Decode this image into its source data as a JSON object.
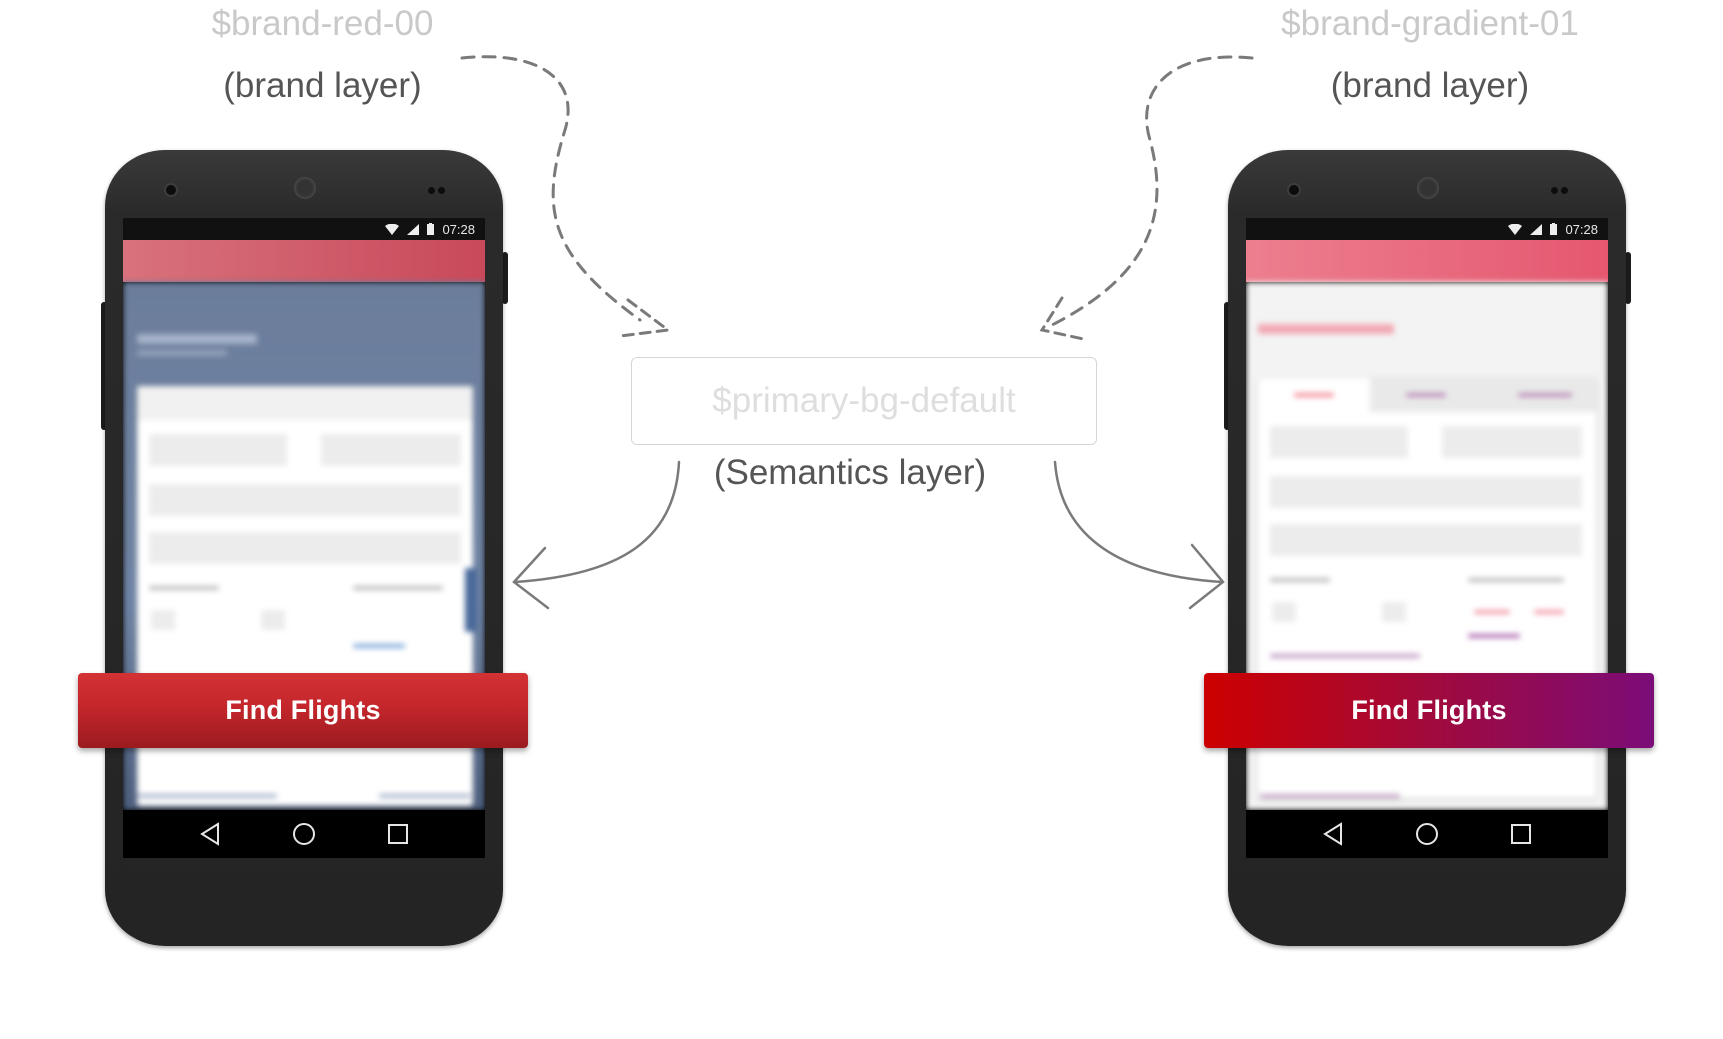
{
  "left": {
    "token": "$brand-red-00",
    "layer_label": "(brand layer)",
    "phone": {
      "time": "07:28",
      "button_label": "Find Flights",
      "button_color_top": "#d33235",
      "button_color_bottom": "#9b1b1f",
      "appbar_color": "#cc4b5b",
      "body_color": "#6d809f"
    }
  },
  "center": {
    "token": "$primary-bg-default",
    "layer_label": "(Semantics layer)"
  },
  "right": {
    "token": "$brand-gradient-01",
    "layer_label": "(brand layer)",
    "phone": {
      "time": "07:28",
      "button_label": "Find Flights",
      "gradient_start": "#cc0000",
      "gradient_end": "#7b0c78",
      "appbar_color": "#e86a80",
      "body_color": "#f3f3f3"
    }
  },
  "icons": {
    "wifi": "wifi-icon",
    "signal": "signal-icon",
    "battery": "battery-icon",
    "back": "back-icon",
    "home": "home-icon",
    "recents": "recents-icon"
  }
}
